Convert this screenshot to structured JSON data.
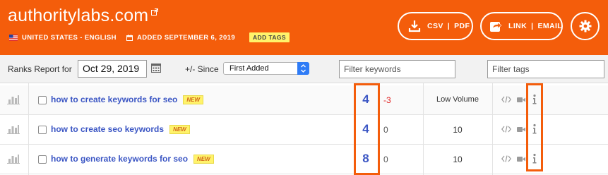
{
  "header": {
    "site_title": "authoritylabs.com",
    "locale": "UNITED STATES - ENGLISH",
    "added": "ADDED SEPTEMBER 6, 2019",
    "add_tags_label": "ADD TAGS",
    "csv_label": "CSV",
    "pdf_label": "PDF",
    "link_label": "LINK",
    "email_label": "EMAIL",
    "separator": "|",
    "background_color": "#f45d0b"
  },
  "toolbar": {
    "ranks_report_label": "Ranks Report for",
    "date_value": "Oct 29, 2019",
    "since_label": "+/- Since",
    "since_selected": "First Added",
    "filter_keywords_placeholder": "Filter keywords",
    "filter_tags_placeholder": "Filter tags"
  },
  "rows": [
    {
      "keyword": "how to create keywords for seo",
      "badge": "NEW",
      "rank": "4",
      "change": "-3",
      "volume": "Low Volume"
    },
    {
      "keyword": "how to create seo keywords",
      "badge": "NEW",
      "rank": "4",
      "change": "0",
      "volume": "10"
    },
    {
      "keyword": "how to generate keywords for seo",
      "badge": "NEW",
      "rank": "8",
      "change": "0",
      "volume": "10"
    }
  ],
  "icons": [
    "external-link-icon",
    "us-flag-icon",
    "calendar-icon",
    "download-icon",
    "share-icon",
    "gear-icon",
    "bar-chart-icon",
    "code-icon",
    "video-icon",
    "info-icon"
  ],
  "colors": {
    "brand_orange": "#f45d0b",
    "link_blue": "#3b56c4",
    "negative_red": "#e02020",
    "badge_yellow": "#fff36b"
  }
}
